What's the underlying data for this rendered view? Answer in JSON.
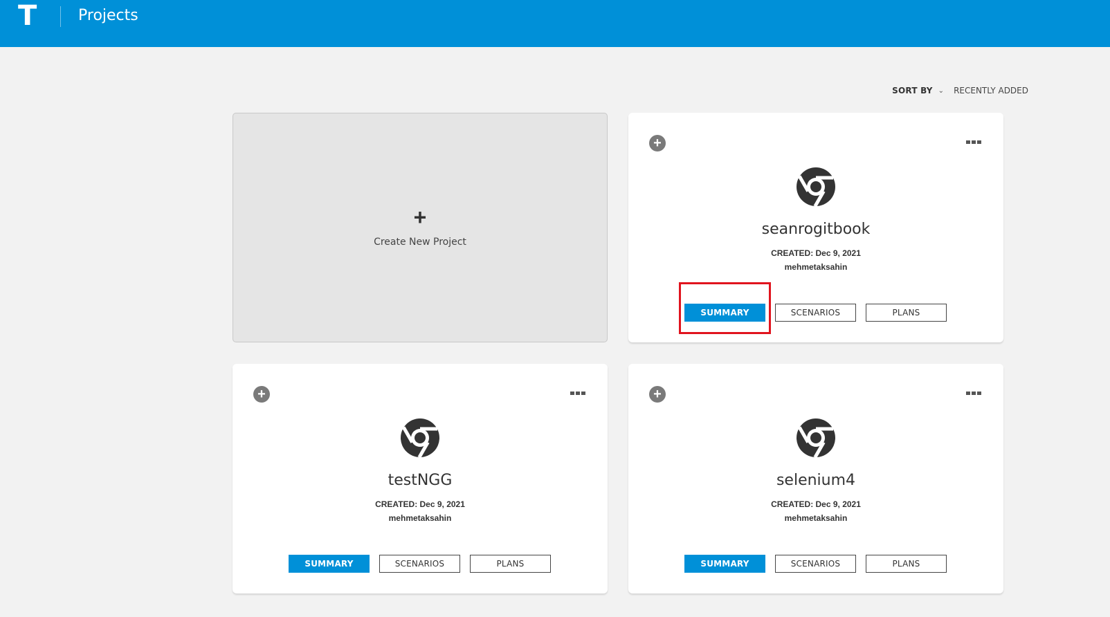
{
  "header": {
    "logo": "T",
    "title": "Projects"
  },
  "sort": {
    "label": "SORT BY",
    "value": "RECENTLY ADDED"
  },
  "new_project": {
    "plus": "+",
    "label": "Create New Project"
  },
  "projects": [
    {
      "name": "seanrogitbook",
      "created": "CREATED: Dec 9, 2021",
      "owner": "mehmetaksahin",
      "buttons": {
        "summary": "SUMMARY",
        "scenarios": "SCENARIOS",
        "plans": "PLANS"
      }
    },
    {
      "name": "testNGG",
      "created": "CREATED: Dec 9, 2021",
      "owner": "mehmetaksahin",
      "buttons": {
        "summary": "SUMMARY",
        "scenarios": "SCENARIOS",
        "plans": "PLANS"
      }
    },
    {
      "name": "selenium4",
      "created": "CREATED: Dec 9, 2021",
      "owner": "mehmetaksahin",
      "buttons": {
        "summary": "SUMMARY",
        "scenarios": "SCENARIOS",
        "plans": "PLANS"
      }
    }
  ],
  "icons": {
    "add": "plus-circle-icon",
    "more": "more-options-icon",
    "browser": "chrome-icon"
  },
  "colors": {
    "brand": "#0090d8",
    "highlight": "#e0141e"
  }
}
